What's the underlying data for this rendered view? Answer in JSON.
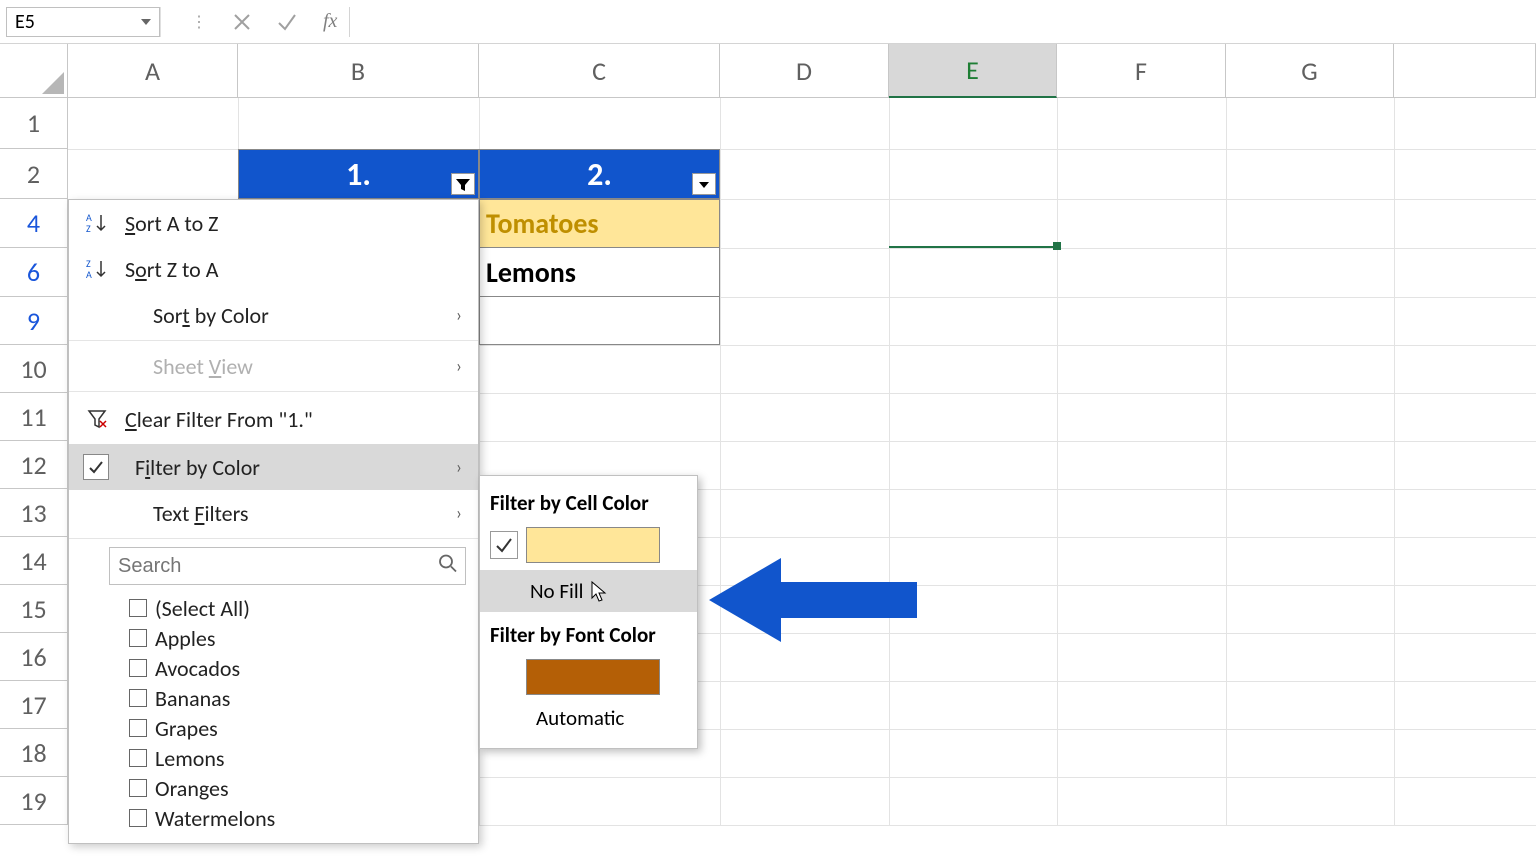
{
  "formula_bar": {
    "name_box": "E5",
    "fx_label": "fx",
    "value": ""
  },
  "columns": [
    "A",
    "B",
    "C",
    "D",
    "E",
    "F",
    "G"
  ],
  "selected_column": "E",
  "visible_rows": [
    "1",
    "2",
    "4",
    "6",
    "9",
    "10",
    "11",
    "12",
    "13",
    "14",
    "15",
    "16",
    "17",
    "18",
    "19"
  ],
  "filtered_row_indices": [
    "4",
    "6",
    "9"
  ],
  "table": {
    "header1": "1.",
    "header2": "2.",
    "row4": "Tomatoes",
    "row6": "Lemons"
  },
  "menu": {
    "sort_az": "Sort A to Z",
    "sort_za": "Sort Z to A",
    "sort_color": "Sort by Color",
    "sheet_view": "Sheet View",
    "clear_filter": "Clear Filter From \"1.\"",
    "filter_by_color": "Filter by Color",
    "text_filters": "Text Filters",
    "search_placeholder": "Search",
    "checklist": [
      "(Select All)",
      "Apples",
      "Avocados",
      "Bananas",
      "Grapes",
      "Lemons",
      "Oranges",
      "Watermelons"
    ]
  },
  "submenu": {
    "cell_heading": "Filter by Cell Color",
    "no_fill": "No Fill",
    "font_heading": "Filter by Font Color",
    "automatic": "Automatic",
    "cell_color_swatch": "#ffe699",
    "font_color_swatch": "#b45f06"
  },
  "chart_data": {
    "type": "table",
    "title": "Spreadsheet filter menu — Filter by Color submenu open",
    "columns": [
      "1.",
      "2."
    ],
    "rows_visible": [
      {
        "row": 4,
        "col2": "Tomatoes",
        "cell_fill": "#ffe699",
        "font_color": "#bf8f00"
      },
      {
        "row": 6,
        "col2": "Lemons",
        "cell_fill": null,
        "font_color": "#000000"
      },
      {
        "row": 9,
        "col2": "",
        "cell_fill": null,
        "font_color": null
      }
    ],
    "filter_column": "1.",
    "filter_checklist": [
      "(Select All)",
      "Apples",
      "Avocados",
      "Bananas",
      "Grapes",
      "Lemons",
      "Oranges",
      "Watermelons"
    ],
    "hovered_option": "No Fill"
  }
}
